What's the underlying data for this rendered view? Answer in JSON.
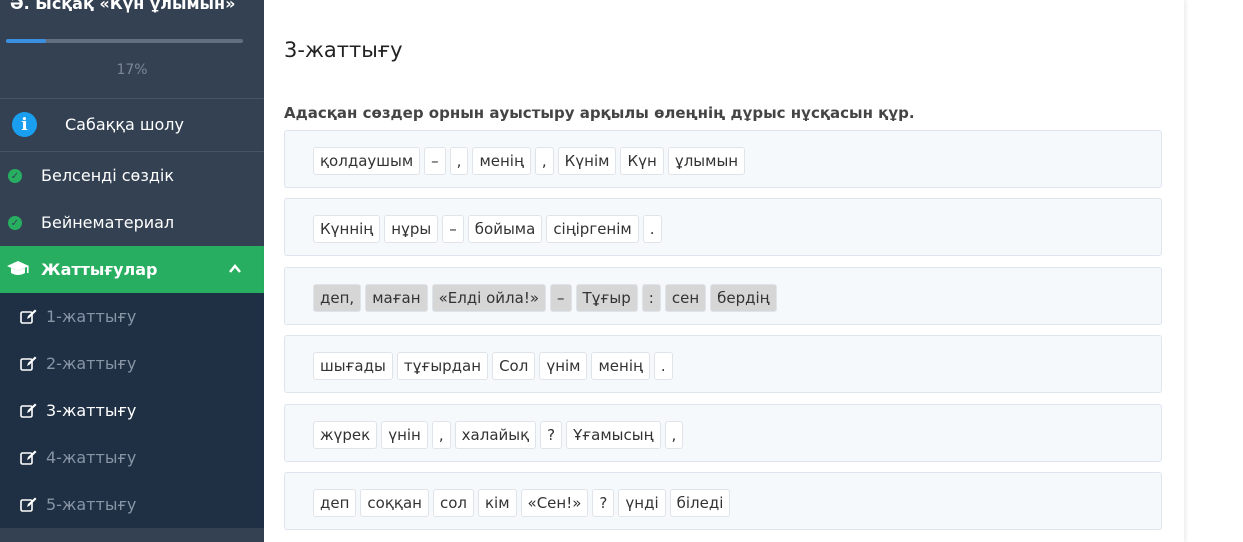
{
  "sidebar": {
    "course_title": "Ә. Ысқақ «Күн ұлымын»",
    "progress_percent": 17,
    "progress_label": "17%",
    "overview_label": "Сабаққа шолу",
    "completed_items": [
      {
        "label": "Белсенді сөздік"
      },
      {
        "label": "Бейнематериал"
      }
    ],
    "active_section_label": "Жаттығулар",
    "exercises": [
      {
        "label": "1-жаттығу"
      },
      {
        "label": "2-жаттығу"
      },
      {
        "label": "3-жаттығу"
      },
      {
        "label": "4-жаттығу"
      },
      {
        "label": "5-жаттығу"
      }
    ],
    "current_exercise_index": 2,
    "icons": {
      "overview": "info-icon",
      "completed": "check-circle-icon",
      "section": "graduation-cap-icon",
      "collapse": "chevron-up-icon",
      "exercise": "edit-icon"
    }
  },
  "main": {
    "title": "3-жаттығу",
    "instruction": "Адасқан сөздер орнын ауыстыру арқылы өлеңнің дұрыс нұсқасын құр.",
    "rows": [
      {
        "tokens": [
          "қолдаушым",
          "–",
          ",",
          "менің",
          ",",
          "Күнім",
          "Күн",
          "ұлымын"
        ]
      },
      {
        "tokens": [
          "Күннің",
          "нұры",
          "–",
          "бойыма",
          "сіңіргенім",
          "."
        ]
      },
      {
        "tokens": [
          "деп,",
          "маған",
          "«Елді ойла!»",
          "–",
          "Тұғыр",
          ":",
          "сен",
          "бердің"
        ],
        "highlighted": true
      },
      {
        "tokens": [
          "шығады",
          "тұғырдан",
          "Сол",
          "үнім",
          "менің",
          "."
        ]
      },
      {
        "tokens": [
          "жүрек",
          "үнін",
          ",",
          "халайық",
          "?",
          "Ұғамысың",
          ","
        ]
      },
      {
        "tokens": [
          "деп",
          "соққан",
          "сол",
          "кім",
          "«Сен!»",
          "?",
          "үнді",
          "біледі"
        ]
      }
    ]
  },
  "colors": {
    "sidebar_bg": "#334152",
    "sub_panel_bg": "#1f2f44",
    "active_green": "#27ae60",
    "progress_blue": "#3b8fe0",
    "info_blue": "#1a9ef0"
  }
}
